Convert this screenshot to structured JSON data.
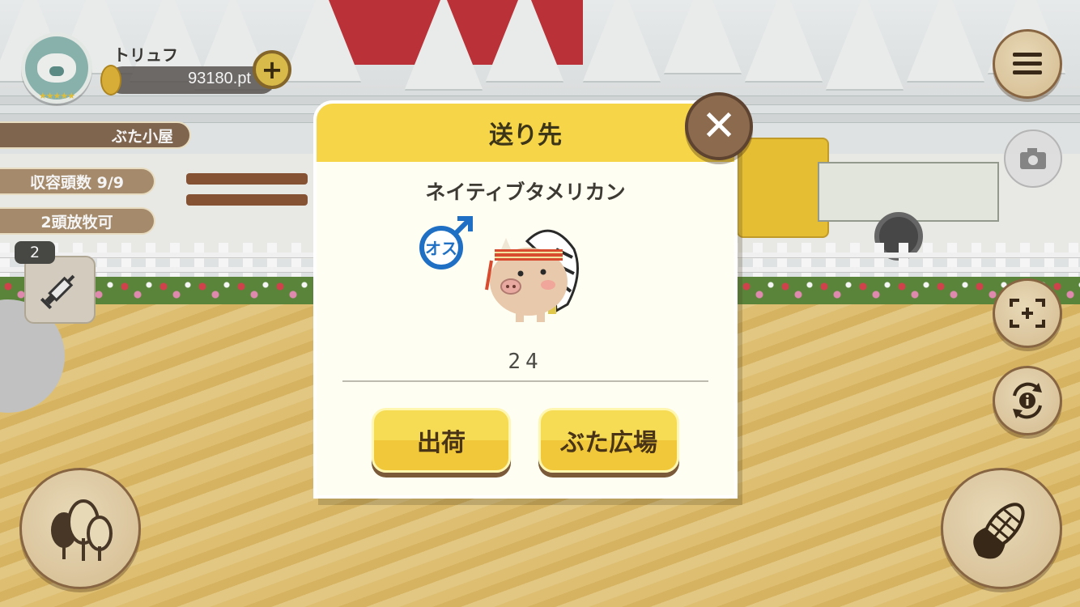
{
  "hud": {
    "player_name": "トリュフ",
    "points": "93180.pt",
    "add_label": "+",
    "stars": "★★★★★"
  },
  "side_panel": {
    "location": "ぶた小屋",
    "capacity": "収容頭数 9/9",
    "grazing": "2頭放牧可",
    "item_count": "2"
  },
  "dialog": {
    "title": "送り先",
    "close_label": "✕",
    "breed_name": "ネイティブタメリカン",
    "gender_label": "オス",
    "age": "24",
    "buttons": {
      "ship": "出荷",
      "plaza": "ぶた広場"
    }
  },
  "icons": {
    "menu": "menu-icon",
    "camera": "camera-icon",
    "focus": "focus-icon",
    "info": "info-icon",
    "trees": "trees-icon",
    "corn": "corn-icon",
    "syringe": "syringe-icon",
    "coin": "coin-icon"
  },
  "colors": {
    "header_yellow": "#f7d548",
    "button_yellow": "#f1c83a",
    "wood_brown": "#8c6a4d",
    "male_blue": "#1f6fc4"
  }
}
